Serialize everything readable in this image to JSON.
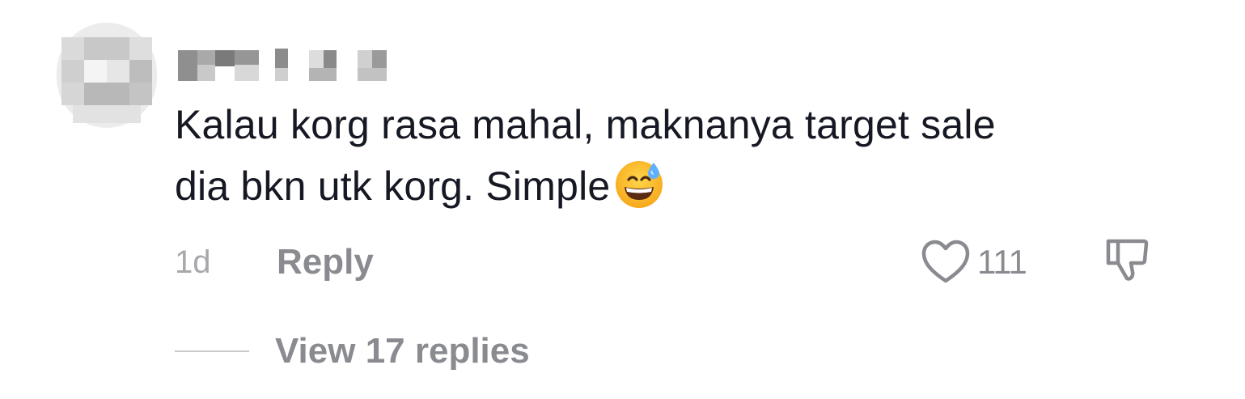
{
  "comment": {
    "text_line1": "Kalau korg rasa mahal, maknanya target sale",
    "text_line2": "dia bkn utk korg. Simple",
    "emoji": "grinning-face-with-sweat"
  },
  "meta": {
    "timestamp": "1d",
    "reply_label": "Reply",
    "like_count": "111"
  },
  "replies": {
    "view_label": "View 17 replies"
  },
  "colors": {
    "text": "#161823",
    "secondary": "#8a8b91",
    "muted": "#a7a8ab"
  },
  "icons": {
    "like": "heart-icon",
    "dislike": "thumbs-down-icon"
  }
}
